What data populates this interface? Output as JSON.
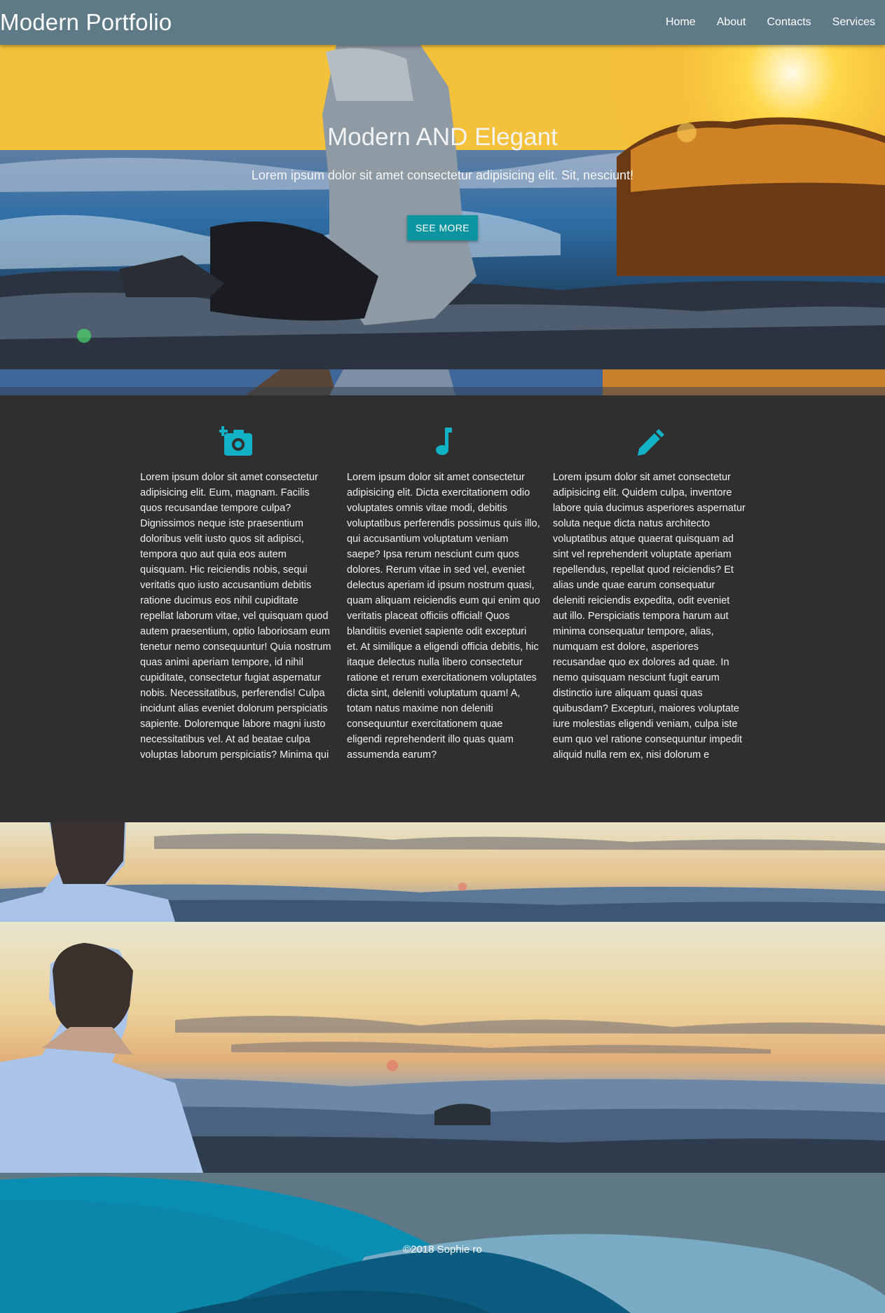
{
  "nav": {
    "brand": "Modern Portfolio",
    "links": [
      "Home",
      "About",
      "Contacts",
      "Services"
    ]
  },
  "hero": {
    "title": "Modern AND Elegant",
    "subtitle": "Lorem ipsum dolor sit amet consectetur adipisicing elit. Sit, nesciunt!",
    "button": "SEE MORE"
  },
  "features": [
    {
      "icon": "camera-add-icon",
      "text": "Lorem ipsum dolor sit amet consectetur adipisicing elit. Eum, magnam. Facilis quos recusandae tempore culpa? Dignissimos neque iste praesentium doloribus velit iusto quos sit adipisci, tempora quo aut quia eos autem quisquam. Hic reiciendis nobis, sequi veritatis quo iusto accusantium debitis ratione ducimus eos nihil cupiditate repellat laborum vitae, vel quisquam quod autem praesentium, optio laboriosam eum tenetur nemo consequuntur! Quia nostrum quas animi aperiam tempore, id nihil cupiditate, consectetur fugiat aspernatur nobis. Necessitatibus, perferendis! Culpa incidunt alias eveniet dolorum perspiciatis sapiente. Doloremque labore magni iusto necessitatibus vel. At ad beatae culpa voluptas laborum perspiciatis? Minima qui"
    },
    {
      "icon": "music-note-icon",
      "text": "Lorem ipsum dolor sit amet consectetur adipisicing elit. Dicta exercitationem odio voluptates omnis vitae modi, debitis voluptatibus perferendis possimus quis illo, qui accusantium voluptatum veniam saepe? Ipsa rerum nesciunt cum quos dolores. Rerum vitae in sed vel, eveniet delectus aperiam id ipsum nostrum quasi, quam aliquam reiciendis eum qui enim quo veritatis placeat officiis official! Quos blanditiis eveniet sapiente odit excepturi et. At similique a eligendi officia debitis, hic itaque delectus nulla libero consectetur ratione et rerum exercitationem voluptates dicta sint, deleniti voluptatum quam! A, totam natus maxime non deleniti consequuntur exercitationem quae eligendi reprehenderit illo quas quam assumenda earum?"
    },
    {
      "icon": "pencil-icon",
      "text": "Lorem ipsum dolor sit amet consectetur adipisicing elit. Quidem culpa, inventore labore quia ducimus asperiores aspernatur soluta neque dicta natus architecto voluptatibus atque quaerat quisquam ad sint vel reprehenderit voluptate aperiam repellendus, repellat quod reiciendis? Et alias unde quae earum consequatur deleniti reiciendis expedita, odit eveniet aut illo. Perspiciatis tempora harum aut minima consequatur tempore, alias, numquam est dolore, asperiores recusandae quo ex dolores ad quae. In nemo quisquam nesciunt fugit earum distinctio iure aliquam quasi quas quibusdam? Excepturi, maiores voluptate iure molestias eligendi veniam, culpa iste eum quo vel ratione consequuntur impedit aliquid nulla rem ex, nisi dolorum e"
    }
  ],
  "footer": {
    "text": "©2018 Sophie ro"
  },
  "colors": {
    "navbar": "#5f7a87",
    "accent": "#0c95a0",
    "icon": "#12b2c6",
    "dark": "#2f2f2f"
  }
}
